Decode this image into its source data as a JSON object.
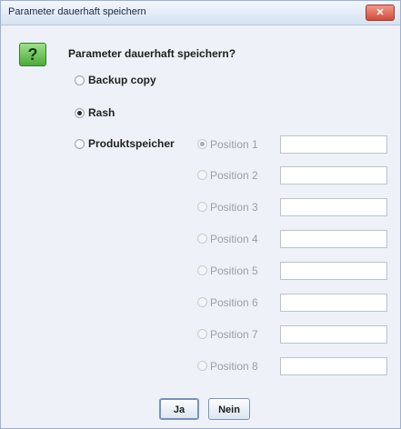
{
  "window": {
    "title": "Parameter dauerhaft speichern",
    "close_label": "✕"
  },
  "dialog": {
    "icon_label": "?",
    "question": "Parameter dauerhaft speichern?",
    "options": [
      {
        "label": "Backup copy",
        "selected": false
      },
      {
        "label": "Rash",
        "selected": true
      },
      {
        "label": "Produktspeicher",
        "selected": false
      }
    ],
    "positions": [
      {
        "label": "Position 1",
        "selected": true,
        "value": ""
      },
      {
        "label": "Position 2",
        "selected": false,
        "value": ""
      },
      {
        "label": "Position 3",
        "selected": false,
        "value": ""
      },
      {
        "label": "Position 4",
        "selected": false,
        "value": ""
      },
      {
        "label": "Position 5",
        "selected": false,
        "value": ""
      },
      {
        "label": "Position 6",
        "selected": false,
        "value": ""
      },
      {
        "label": "Position 7",
        "selected": false,
        "value": ""
      },
      {
        "label": "Position 8",
        "selected": false,
        "value": ""
      }
    ],
    "buttons": {
      "yes": "Ja",
      "no": "Nein"
    }
  }
}
